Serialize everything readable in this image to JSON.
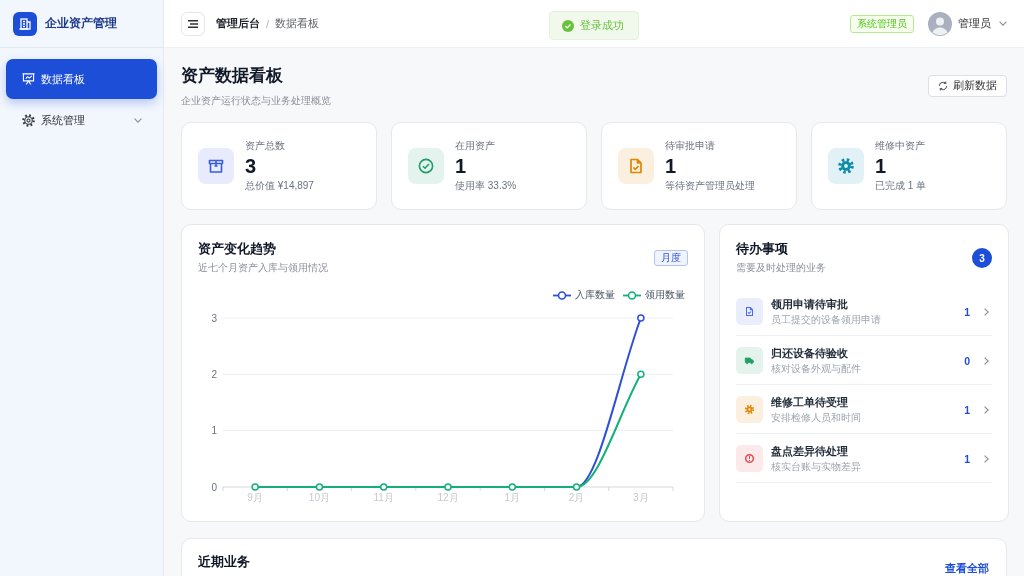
{
  "sidebar": {
    "title": "企业资产管理",
    "items": [
      {
        "label": "数据看板",
        "kind": "page",
        "selected": true
      },
      {
        "label": "系统管理",
        "kind": "group",
        "selected": false,
        "expanded": false
      }
    ]
  },
  "topbar": {
    "breadcrumb": [
      {
        "label": "管理后台"
      },
      {
        "label": "数据看板"
      }
    ],
    "separator": "/",
    "toast": "登录成功",
    "role_tag": "系统管理员",
    "user_name": "管理员"
  },
  "header": {
    "title": "资产数据看板",
    "subtitle": "企业资产运行状态与业务处理概览",
    "refresh_button": "刷新数据"
  },
  "stats": [
    {
      "label": "资产总数",
      "value": "3",
      "note": "总价值 ¥14,897",
      "color": "#3a5bdc"
    },
    {
      "label": "在用资产",
      "value": "1",
      "note": "使用率 33.3%",
      "color": "#1f9d6b"
    },
    {
      "label": "待审批申请",
      "value": "1",
      "note": "等待资产管理员处理",
      "color": "#e08600"
    },
    {
      "label": "维修中资产",
      "value": "1",
      "note": "已完成 1 单",
      "color": "#0e8ba8"
    }
  ],
  "trend": {
    "title": "资产变化趋势",
    "subtitle": "近七个月资产入库与领用情况",
    "period_tag": "月度",
    "chart_data": {
      "type": "line",
      "categories": [
        "9月",
        "10月",
        "11月",
        "12月",
        "1月",
        "2月",
        "3月"
      ],
      "series": [
        {
          "name": "入库数量",
          "color": "#2f4fd6",
          "marker": "circle",
          "values": [
            null,
            null,
            null,
            null,
            null,
            0,
            3
          ]
        },
        {
          "name": "领用数量",
          "color": "#14b07a",
          "marker": "circle",
          "values": [
            0,
            0,
            0,
            0,
            0,
            0,
            2
          ]
        }
      ],
      "legend": "top-right",
      "ylim": [
        0,
        3
      ],
      "yticks": [
        0,
        1,
        2,
        3
      ]
    }
  },
  "todos": {
    "title": "待办事项",
    "subtitle": "需要及时处理的业务",
    "badge": "3",
    "items": [
      {
        "title": "领用申请待审批",
        "description": "员工提交的设备领用申请",
        "count": "1",
        "color": "#4a6ae6"
      },
      {
        "title": "归还设备待验收",
        "description": "核对设备外观与配件",
        "count": "0",
        "color": "#22a06b"
      },
      {
        "title": "维修工单待受理",
        "description": "安排检修人员和时间",
        "count": "1",
        "color": "#e08600"
      },
      {
        "title": "盘点差异待处理",
        "description": "核实台账与实物差异",
        "count": "1",
        "color": "#e5484d"
      }
    ]
  },
  "recent": {
    "title": "近期业务",
    "link": "查看全部"
  }
}
